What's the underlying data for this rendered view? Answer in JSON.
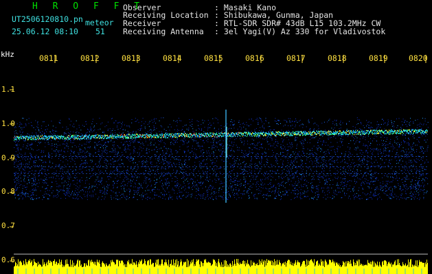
{
  "header": {
    "app_name": "H R O F F T",
    "file_name": "UT2506120810.pn",
    "meteor_label": "meteor",
    "date_time": "25.06.12 08:10",
    "count": "51",
    "fields": [
      {
        "label": "Observer",
        "value": ": Masaki Kano"
      },
      {
        "label": "Receiving Location",
        "value": ": Shibukawa, Gunma, Japan"
      },
      {
        "label": "Receiver",
        "value": ": RTL-SDR SDR# 43dB L15 103.2MHz CW"
      },
      {
        "label": "Receiving Antenna",
        "value": ": 3el Yagi(V) Az 330 for Vladivostok"
      }
    ]
  },
  "chart_data": {
    "type": "heatmap",
    "ylabel": "kHz",
    "y_ticks": [
      "1.1",
      "1.0",
      "0.9",
      "0.8",
      "0.7",
      "0.6"
    ],
    "x_ticks": [
      "0811",
      "0812",
      "0813",
      "0814",
      "0815",
      "0816",
      "0817",
      "0818",
      "0819",
      "0820"
    ],
    "ylim": [
      0.6,
      1.15
    ],
    "signal_band_khz": [
      0.78,
      1.0
    ],
    "carrier_khz": [
      0.96,
      0.98
    ],
    "colors": {
      "axis_text": "#ffe040",
      "header_green": "#00e000",
      "header_cyan": "#3fe0e0",
      "bottom_trace": "#ffff00"
    }
  }
}
